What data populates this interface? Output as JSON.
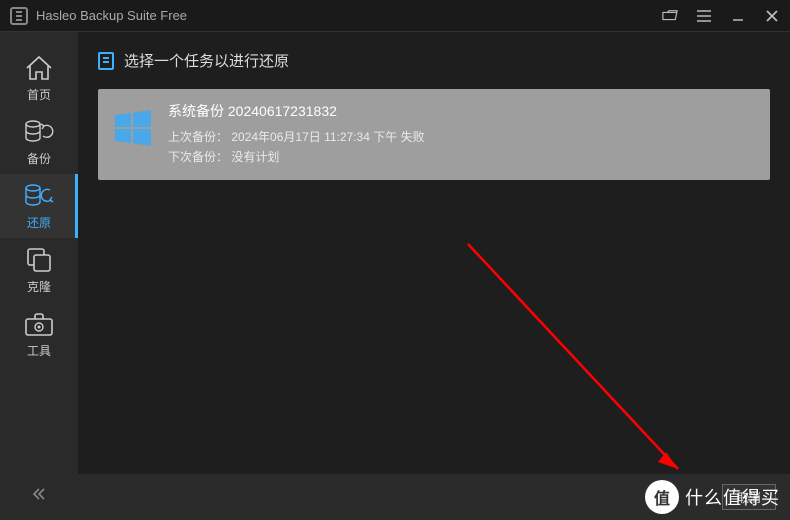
{
  "titlebar": {
    "title": "Hasleo Backup Suite Free"
  },
  "sidebar": {
    "items": [
      {
        "label": "首页"
      },
      {
        "label": "备份"
      },
      {
        "label": "还原"
      },
      {
        "label": "克隆"
      },
      {
        "label": "工具"
      }
    ]
  },
  "header": {
    "text": "选择一个任务以进行还原"
  },
  "task": {
    "title": "系统备份 20240617231832",
    "last_label": "上次备份：",
    "last_value": "2024年06月17日 11:27:34 下午 失败",
    "next_label": "下次备份：",
    "next_value": "没有计划"
  },
  "footer": {
    "cancel": "取消"
  },
  "watermark": {
    "badge": "值",
    "text": "什么值得买"
  }
}
